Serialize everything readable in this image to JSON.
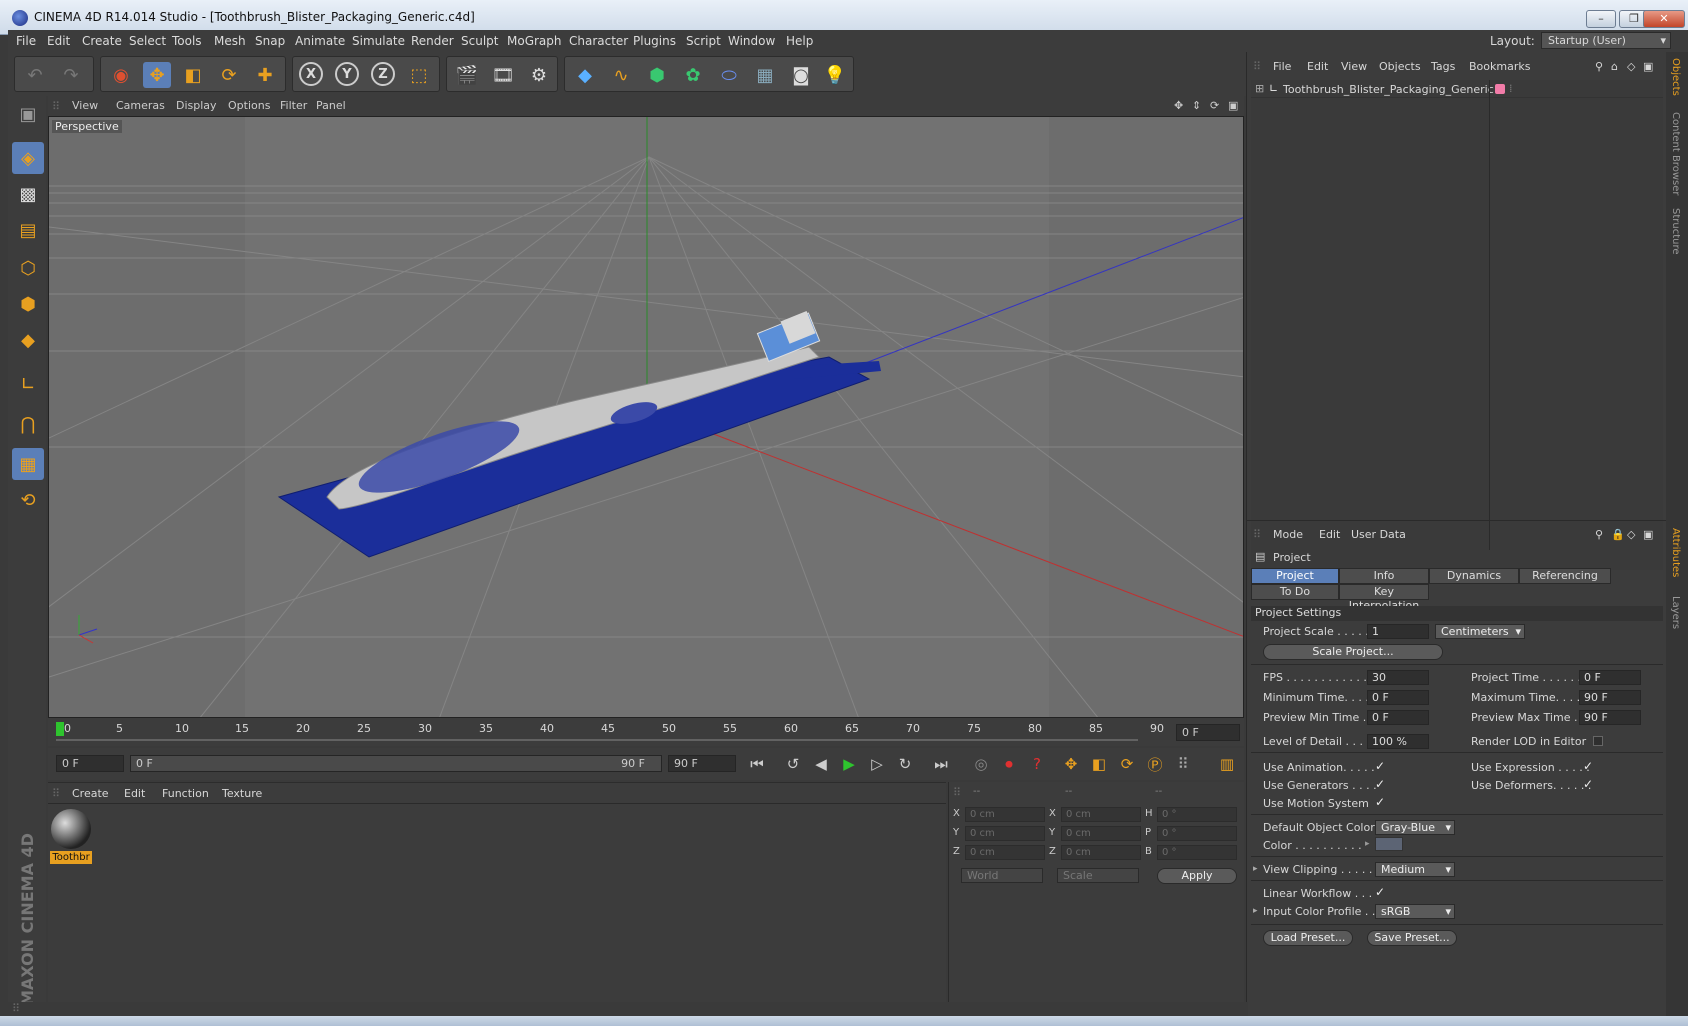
{
  "window": {
    "title": "CINEMA 4D R14.014 Studio - [Toothbrush_Blister_Packaging_Generic.c4d]",
    "controls": [
      "–",
      "❐",
      "✕"
    ]
  },
  "menubar": {
    "items": [
      "File",
      "Edit",
      "Create",
      "Select",
      "Tools",
      "Mesh",
      "Snap",
      "Animate",
      "Simulate",
      "Render",
      "Sculpt",
      "MoGraph",
      "Character",
      "Plugins",
      "Script",
      "Window",
      "Help"
    ],
    "layout_label": "Layout:",
    "layout_value": "Startup (User)"
  },
  "toolbar": {
    "undo": "undo-icon",
    "redo": "redo-icon",
    "axis_x": "X",
    "axis_y": "Y",
    "axis_z": "Z"
  },
  "viewport": {
    "menu": [
      "View",
      "Cameras",
      "Display",
      "Options",
      "Filter",
      "Panel"
    ],
    "label": "Perspective"
  },
  "timeline": {
    "ticks": [
      "0",
      "5",
      "10",
      "15",
      "20",
      "25",
      "30",
      "35",
      "40",
      "45",
      "50",
      "55",
      "60",
      "65",
      "70",
      "75",
      "80",
      "85",
      "90"
    ],
    "current_frame": "0 F"
  },
  "transport": {
    "start_field": "0 F",
    "range_start": "0 F",
    "range_end": "90 F",
    "end_field": "90 F"
  },
  "material_manager": {
    "menu": [
      "Create",
      "Edit",
      "Function",
      "Texture"
    ],
    "materials": [
      {
        "name": "Toothbr"
      }
    ]
  },
  "coordinates": {
    "headers": [
      "--",
      "--",
      "--"
    ],
    "rows": [
      {
        "a_lbl": "X",
        "a": "0 cm",
        "b_lbl": "X",
        "b": "0 cm",
        "c_lbl": "H",
        "c": "0 °"
      },
      {
        "a_lbl": "Y",
        "a": "0 cm",
        "b_lbl": "Y",
        "b": "0 cm",
        "c_lbl": "P",
        "c": "0 °"
      },
      {
        "a_lbl": "Z",
        "a": "0 cm",
        "b_lbl": "Z",
        "b": "0 cm",
        "c_lbl": "B",
        "c": "0 °"
      }
    ],
    "space": "World",
    "mode": "Scale",
    "apply": "Apply"
  },
  "object_manager": {
    "menu": [
      "File",
      "Edit",
      "View",
      "Objects",
      "Tags",
      "Bookmarks"
    ],
    "objects": [
      {
        "name": "Toothbrush_Blister_Packaging_Generic"
      }
    ]
  },
  "attribute_manager": {
    "menu": [
      "Mode",
      "Edit",
      "User Data"
    ],
    "object": "Project",
    "tabs_row1": [
      "Project Settings",
      "Info",
      "Dynamics",
      "Referencing"
    ],
    "tabs_row2": [
      "To Do",
      "Key Interpolation"
    ],
    "section": "Project Settings",
    "project_scale_label": "Project Scale . . . . . .",
    "project_scale": "1",
    "scale_unit": "Centimeters",
    "scale_project_btn": "Scale Project...",
    "fps_label": "FPS . . . . . . . . . . . . . . .",
    "fps": "30",
    "project_time_label": "Project Time . . . . . . . .",
    "project_time": "0 F",
    "min_time_label": "Minimum Time. . . . .",
    "min_time": "0 F",
    "max_time_label": "Maximum Time. . . . . .",
    "max_time": "90 F",
    "prev_min_label": "Preview Min Time . . .",
    "prev_min": "0 F",
    "prev_max_label": "Preview Max Time . . .",
    "prev_max": "90 F",
    "lod_label": "Level of Detail . . . . .",
    "lod": "100 %",
    "render_lod_label": "Render LOD in Editor",
    "use_animation_label": "Use Animation. . . . .",
    "use_expression_label": "Use Expression . . . . .",
    "use_generators_label": "Use Generators . . . .",
    "use_deformers_label": "Use Deformers. . . . . .",
    "use_motion_label": "Use Motion System",
    "default_color_label": "Default Object Color",
    "default_color": "Gray-Blue",
    "color_label": "Color . . . . . . . . . .",
    "view_clipping_label": "View Clipping . . . . . .",
    "view_clipping": "Medium",
    "linear_workflow_label": "Linear Workflow . . .",
    "input_profile_label": "Input Color Profile . .",
    "input_profile": "sRGB",
    "load_preset": "Load Preset...",
    "save_preset": "Save Preset..."
  },
  "side_tabs": [
    "Objects",
    "Content Browser",
    "Structure",
    "Attributes",
    "Layers"
  ],
  "branding": "MAXON CINEMA 4D",
  "colors": {
    "accent": "#e8a020",
    "active_tab": "#5b7fb8",
    "package_blue": "#1b2e9a"
  }
}
